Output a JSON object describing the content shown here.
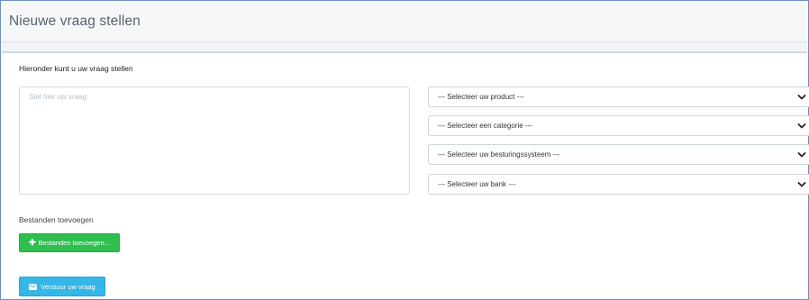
{
  "header": {
    "title": "Nieuwe vraag stellen"
  },
  "form": {
    "intro": "Hieronder kunt u uw vraag stellen",
    "question_placeholder": "Stel hier uw vraag",
    "question_value": "",
    "selects": [
      {
        "label": "--- Selecteer uw product ---"
      },
      {
        "label": "--- Selecteer een categorie ---"
      },
      {
        "label": "--- Selecteer uw besturingssysteem ---"
      },
      {
        "label": "--- Selecteer uw bank ---"
      }
    ],
    "files_label": "Bestanden toevoegen",
    "add_files_button": "Bestanden toevoegen...",
    "submit_button": "Verstuur uw vraag"
  },
  "icons": {
    "add": "plus-icon",
    "submit": "envelope-icon",
    "dropdown": "chevron-down-icon"
  },
  "colors": {
    "add_button": "#2fbf4f",
    "submit_button": "#34b7e6",
    "frame_border": "#6a8fc4"
  }
}
